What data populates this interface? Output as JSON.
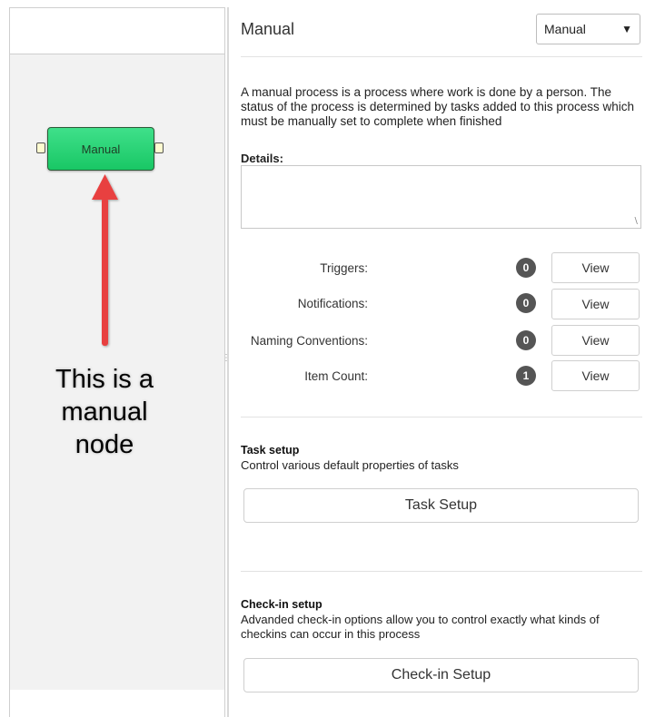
{
  "canvas": {
    "node_label": "Manual",
    "annotation": [
      "This is a",
      "manual",
      "node"
    ]
  },
  "panel": {
    "title": "Manual",
    "type_select": {
      "value": "Manual"
    },
    "description": "A manual process is a process where work is done by a person. The status of the process is determined by tasks added to this process which must be manually set to complete when finished",
    "details_label": "Details:",
    "details_value": "",
    "rows": [
      {
        "label": "Triggers:",
        "count": "0",
        "button": "View"
      },
      {
        "label": "Notifications:",
        "count": "0",
        "button": "View"
      },
      {
        "label": "Naming Conventions:",
        "count": "0",
        "button": "View"
      },
      {
        "label": "Item Count:",
        "count": "1",
        "button": "View"
      }
    ],
    "task_setup": {
      "heading": "Task setup",
      "description": "Control various default properties of tasks",
      "button": "Task Setup"
    },
    "checkin_setup": {
      "heading": "Check-in setup",
      "description": "Advanded check-in options allow you to control exactly what kinds of checkins can occur in this process",
      "button": "Check-in Setup"
    }
  },
  "colors": {
    "node_fill": "#1fd06c",
    "arrow": "#e8403f",
    "badge": "#555555"
  }
}
